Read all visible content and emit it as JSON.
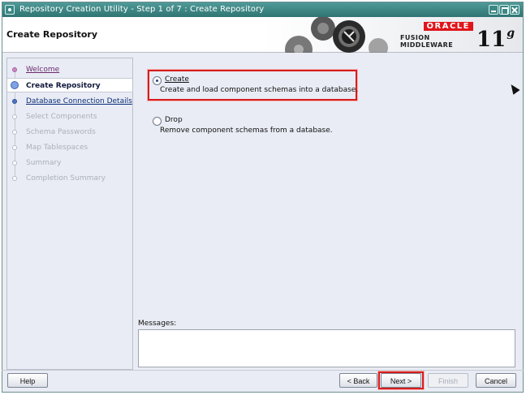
{
  "window": {
    "title": "Repository Creation Utility - Step 1 of 7 : Create Repository"
  },
  "header": {
    "page_title": "Create Repository",
    "brand": "ORACLE",
    "product": "FUSION MIDDLEWARE",
    "version": "11",
    "version_suffix": "g"
  },
  "nav": {
    "items": [
      {
        "label": "Welcome",
        "state": "done"
      },
      {
        "label": "Create Repository",
        "state": "current"
      },
      {
        "label": "Database Connection Details",
        "state": "next"
      },
      {
        "label": "Select Components",
        "state": "disabled"
      },
      {
        "label": "Schema Passwords",
        "state": "disabled"
      },
      {
        "label": "Map Tablespaces",
        "state": "disabled"
      },
      {
        "label": "Summary",
        "state": "disabled"
      },
      {
        "label": "Completion Summary",
        "state": "disabled"
      }
    ]
  },
  "options": {
    "create": {
      "label": "Create",
      "description": "Create and load component schemas into a database.",
      "selected": true
    },
    "drop": {
      "label": "Drop",
      "description": "Remove component schemas from a database.",
      "selected": false
    }
  },
  "messages": {
    "label": "Messages:",
    "content": ""
  },
  "buttons": {
    "help": "Help",
    "back": "< Back",
    "next": "Next >",
    "finish": "Finish",
    "cancel": "Cancel"
  },
  "colors": {
    "title_bar": "#2f7573",
    "highlight": "#d61d1d",
    "oracle_red": "#e0161b",
    "panel_bg": "#e9ecf4"
  }
}
